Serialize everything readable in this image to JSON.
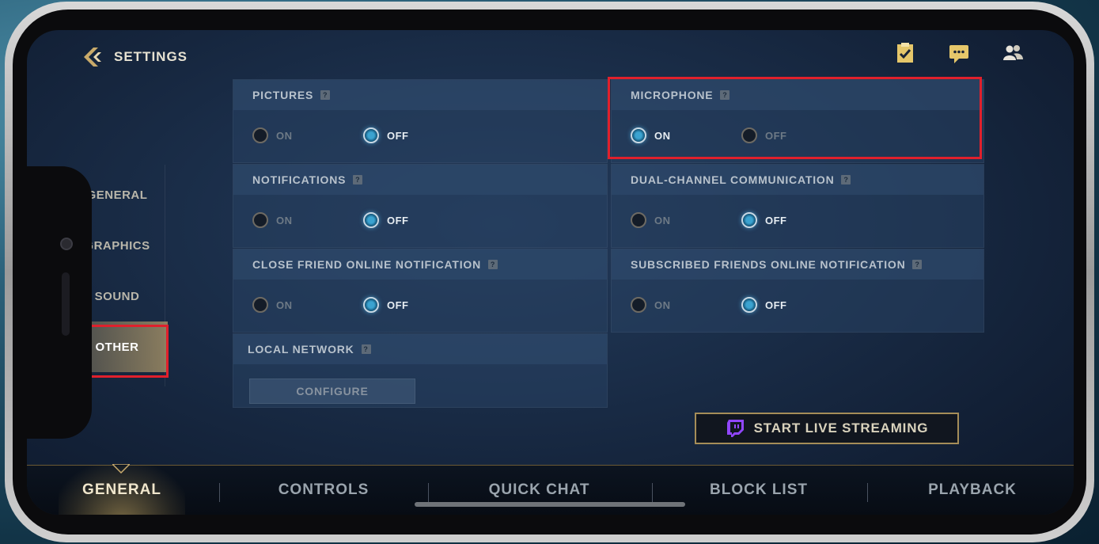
{
  "header": {
    "title": "SETTINGS"
  },
  "top_icons": [
    "clipboard-check-icon",
    "chat-bubble-icon",
    "friends-icon"
  ],
  "side_nav": [
    {
      "label": "GENERAL"
    },
    {
      "label": "GRAPHICS"
    },
    {
      "label": "SOUND"
    },
    {
      "label": "OTHER",
      "active": true
    }
  ],
  "settings": {
    "pictures": {
      "label": "PICTURES",
      "on": "ON",
      "off": "OFF",
      "selected": "off"
    },
    "microphone": {
      "label": "MICROPHONE",
      "on": "ON",
      "off": "OFF",
      "selected": "on"
    },
    "notifications": {
      "label": "NOTIFICATIONS",
      "on": "ON",
      "off": "OFF",
      "selected": "off"
    },
    "dual_channel": {
      "label": "DUAL-CHANNEL COMMUNICATION",
      "on": "ON",
      "off": "OFF",
      "selected": "off"
    },
    "close_friend": {
      "label": "CLOSE FRIEND ONLINE NOTIFICATION",
      "on": "ON",
      "off": "OFF",
      "selected": "off"
    },
    "subscribed_friends": {
      "label": "SUBSCRIBED FRIENDS ONLINE NOTIFICATION",
      "on": "ON",
      "off": "OFF",
      "selected": "off"
    },
    "local_network": {
      "label": "LOCAL NETWORK",
      "button": "CONFIGURE"
    }
  },
  "stream_button": {
    "label": "START LIVE STREAMING"
  },
  "bottom_tabs": [
    {
      "label": "GENERAL",
      "active": true
    },
    {
      "label": "CONTROLS"
    },
    {
      "label": "QUICK CHAT"
    },
    {
      "label": "BLOCK LIST"
    },
    {
      "label": "PLAYBACK"
    }
  ],
  "help_glyph": "?",
  "colors": {
    "accent_gold": "#a58d58",
    "radio_on": "#3ba3d0",
    "highlight": "#e0202c"
  }
}
